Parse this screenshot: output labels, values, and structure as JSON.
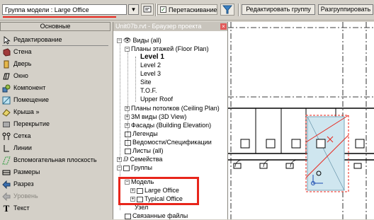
{
  "toolbar": {
    "group_combo_value": "Группа модели : Large Office",
    "drag_checkbox_label": "Перетаскивание",
    "edit_group_button": "Редактировать группу",
    "ungroup_button": "Разгруппировать"
  },
  "design_bar": {
    "header": "Основные",
    "items": [
      {
        "label": "Редактирование",
        "icon": "arrow-icon"
      },
      {
        "label": "Стена",
        "icon": "wall-icon"
      },
      {
        "label": "Дверь",
        "icon": "door-icon"
      },
      {
        "label": "Окно",
        "icon": "window-icon"
      },
      {
        "label": "Компонент",
        "icon": "component-icon"
      },
      {
        "label": "Помещение",
        "icon": "room-icon"
      },
      {
        "label": "Крыша »",
        "icon": "roof-icon"
      },
      {
        "label": "Перекрытие",
        "icon": "floor-icon"
      },
      {
        "label": "Сетка",
        "icon": "grid-icon"
      },
      {
        "label": "Линии",
        "icon": "lines-icon"
      },
      {
        "label": "Вспомогательная плоскость",
        "icon": "ref-plane-icon"
      },
      {
        "label": "Размеры",
        "icon": "dimension-icon"
      },
      {
        "label": "Разрез",
        "icon": "section-icon"
      },
      {
        "label": "Уровень",
        "icon": "level-icon"
      },
      {
        "label": "Текст",
        "icon": "text-icon"
      }
    ]
  },
  "project_browser": {
    "title": "Unit07b.rvt - Браузер проекта",
    "views_all": "Виды (all)",
    "floor_plans": "Планы этажей (Floor Plan)",
    "levels": [
      "Level 1",
      "Level 2",
      "Level 3",
      "Site",
      "T.O.F.",
      "Upper Roof"
    ],
    "ceiling_plans": "Планы потолков (Ceiling Plan)",
    "views_3d": "3М виды (3D View)",
    "elevations": "Фасады (Building Elevation)",
    "legends": "Легенды",
    "schedules": "Ведомости/Спецификации",
    "sheets": "Листы (all)",
    "families": "Семейства",
    "groups": "Группы",
    "model": "Модель",
    "large_office": "Large Office",
    "typical_office": "Typical Office",
    "detail": "Узел",
    "links": "Связанные файлы"
  },
  "colors": {
    "highlight_red": "#e8251b",
    "room_fill": "#cfe6ef"
  }
}
